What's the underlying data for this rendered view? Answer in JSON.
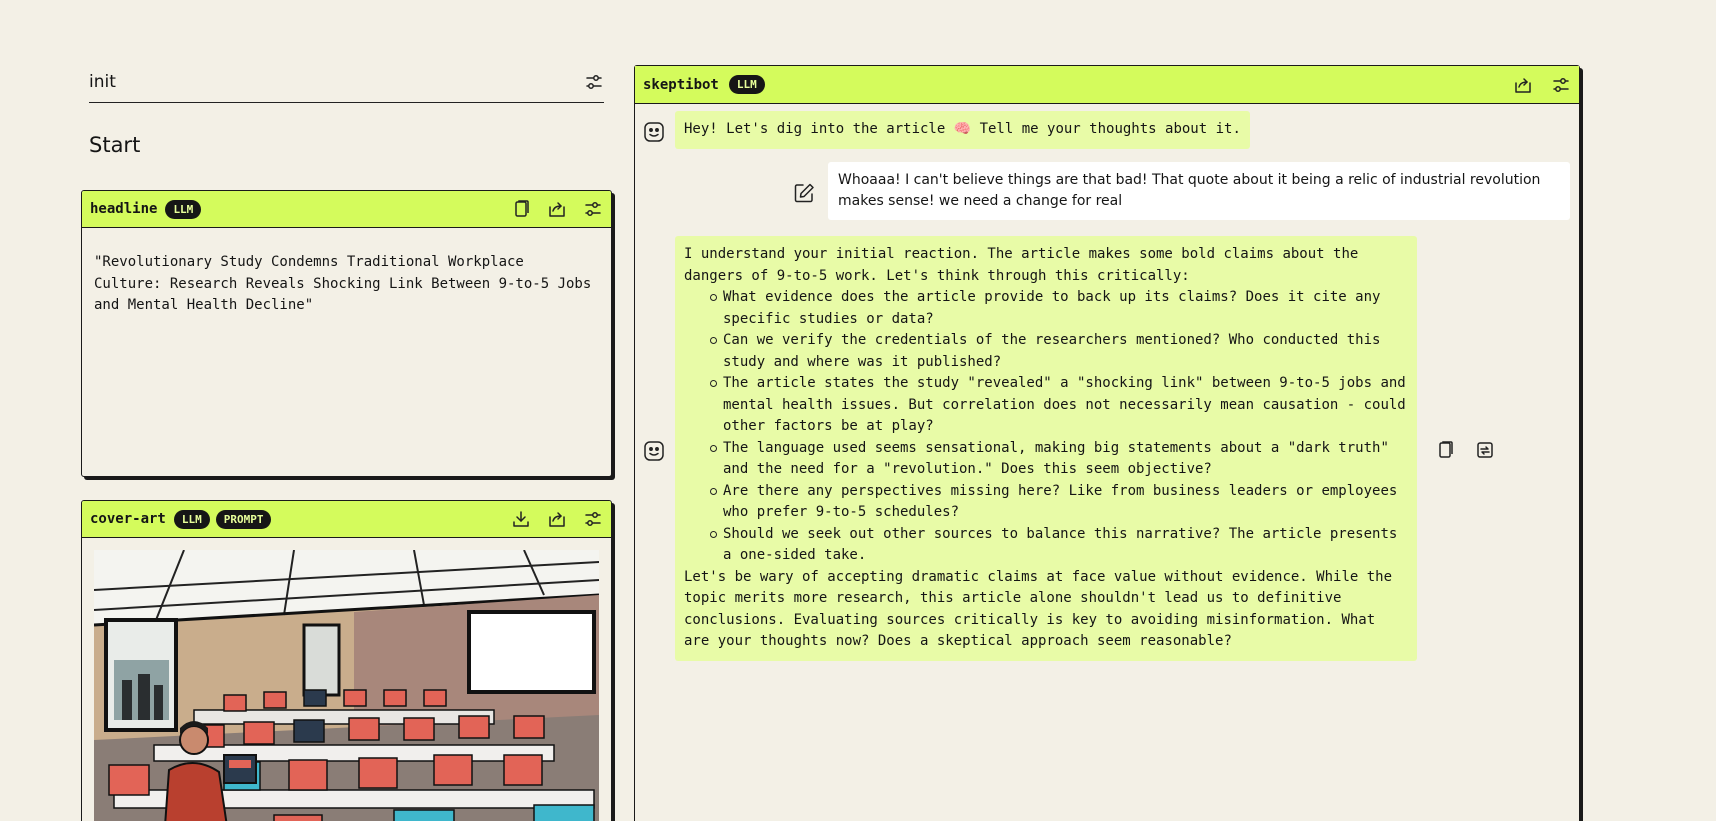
{
  "init": {
    "title": "init"
  },
  "start": {
    "title": "Start"
  },
  "headline_card": {
    "name": "headline",
    "badges": [
      "LLM"
    ],
    "text": "\"Revolutionary Study Condemns Traditional Workplace Culture: Research Reveals Shocking Link Between 9-to-5 Jobs and Mental Health Decline\""
  },
  "cover_card": {
    "name": "cover-art",
    "badges": [
      "LLM",
      "PROMPT"
    ]
  },
  "chat": {
    "name": "skeptibot",
    "badge": "LLM",
    "messages": {
      "greeting": "Hey! Let's dig into the article 🧠 Tell me your thoughts about it.",
      "user": "Whoaaa! I can't believe things are that bad! That quote about it being a relic of industrial revolution makes sense! we need a change for real",
      "reply_intro": "I understand your initial reaction. The article makes some bold claims about the dangers of 9-to-5 work. Let's think through this critically:",
      "reply_points": [
        "What evidence does the article provide to back up its claims? Does it cite any specific studies or data?",
        "Can we verify the credentials of the researchers mentioned? Who conducted this study and where was it published?",
        "The article states the study \"revealed\" a \"shocking link\" between 9-to-5 jobs and mental health issues. But correlation does not necessarily mean causation - could other factors be at play?",
        "The language used seems sensational, making big statements about a \"dark truth\" and the need for a \"revolution.\" Does this seem objective?",
        "Are there any perspectives missing here? Like from business leaders or employees who prefer 9-to-5 schedules?",
        "Should we seek out other sources to balance this narrative? The article presents a one-sided take."
      ],
      "reply_outro": "Let's be wary of accepting dramatic claims at face value without evidence. While the topic merits more research, this article alone shouldn't lead us to definitive conclusions. Evaluating sources critically is key to avoiding misinformation. What are your thoughts now? Does a skeptical approach seem reasonable?"
    }
  },
  "colors": {
    "accent": "#d4fb5c",
    "bot_bubble": "#e8fba7",
    "background": "#f3f0e6",
    "pill": "#161616"
  },
  "icons": [
    "sliders-icon",
    "copy-icon",
    "export-icon",
    "download-icon",
    "bot-face-icon",
    "edit-icon",
    "regenerate-icon"
  ]
}
